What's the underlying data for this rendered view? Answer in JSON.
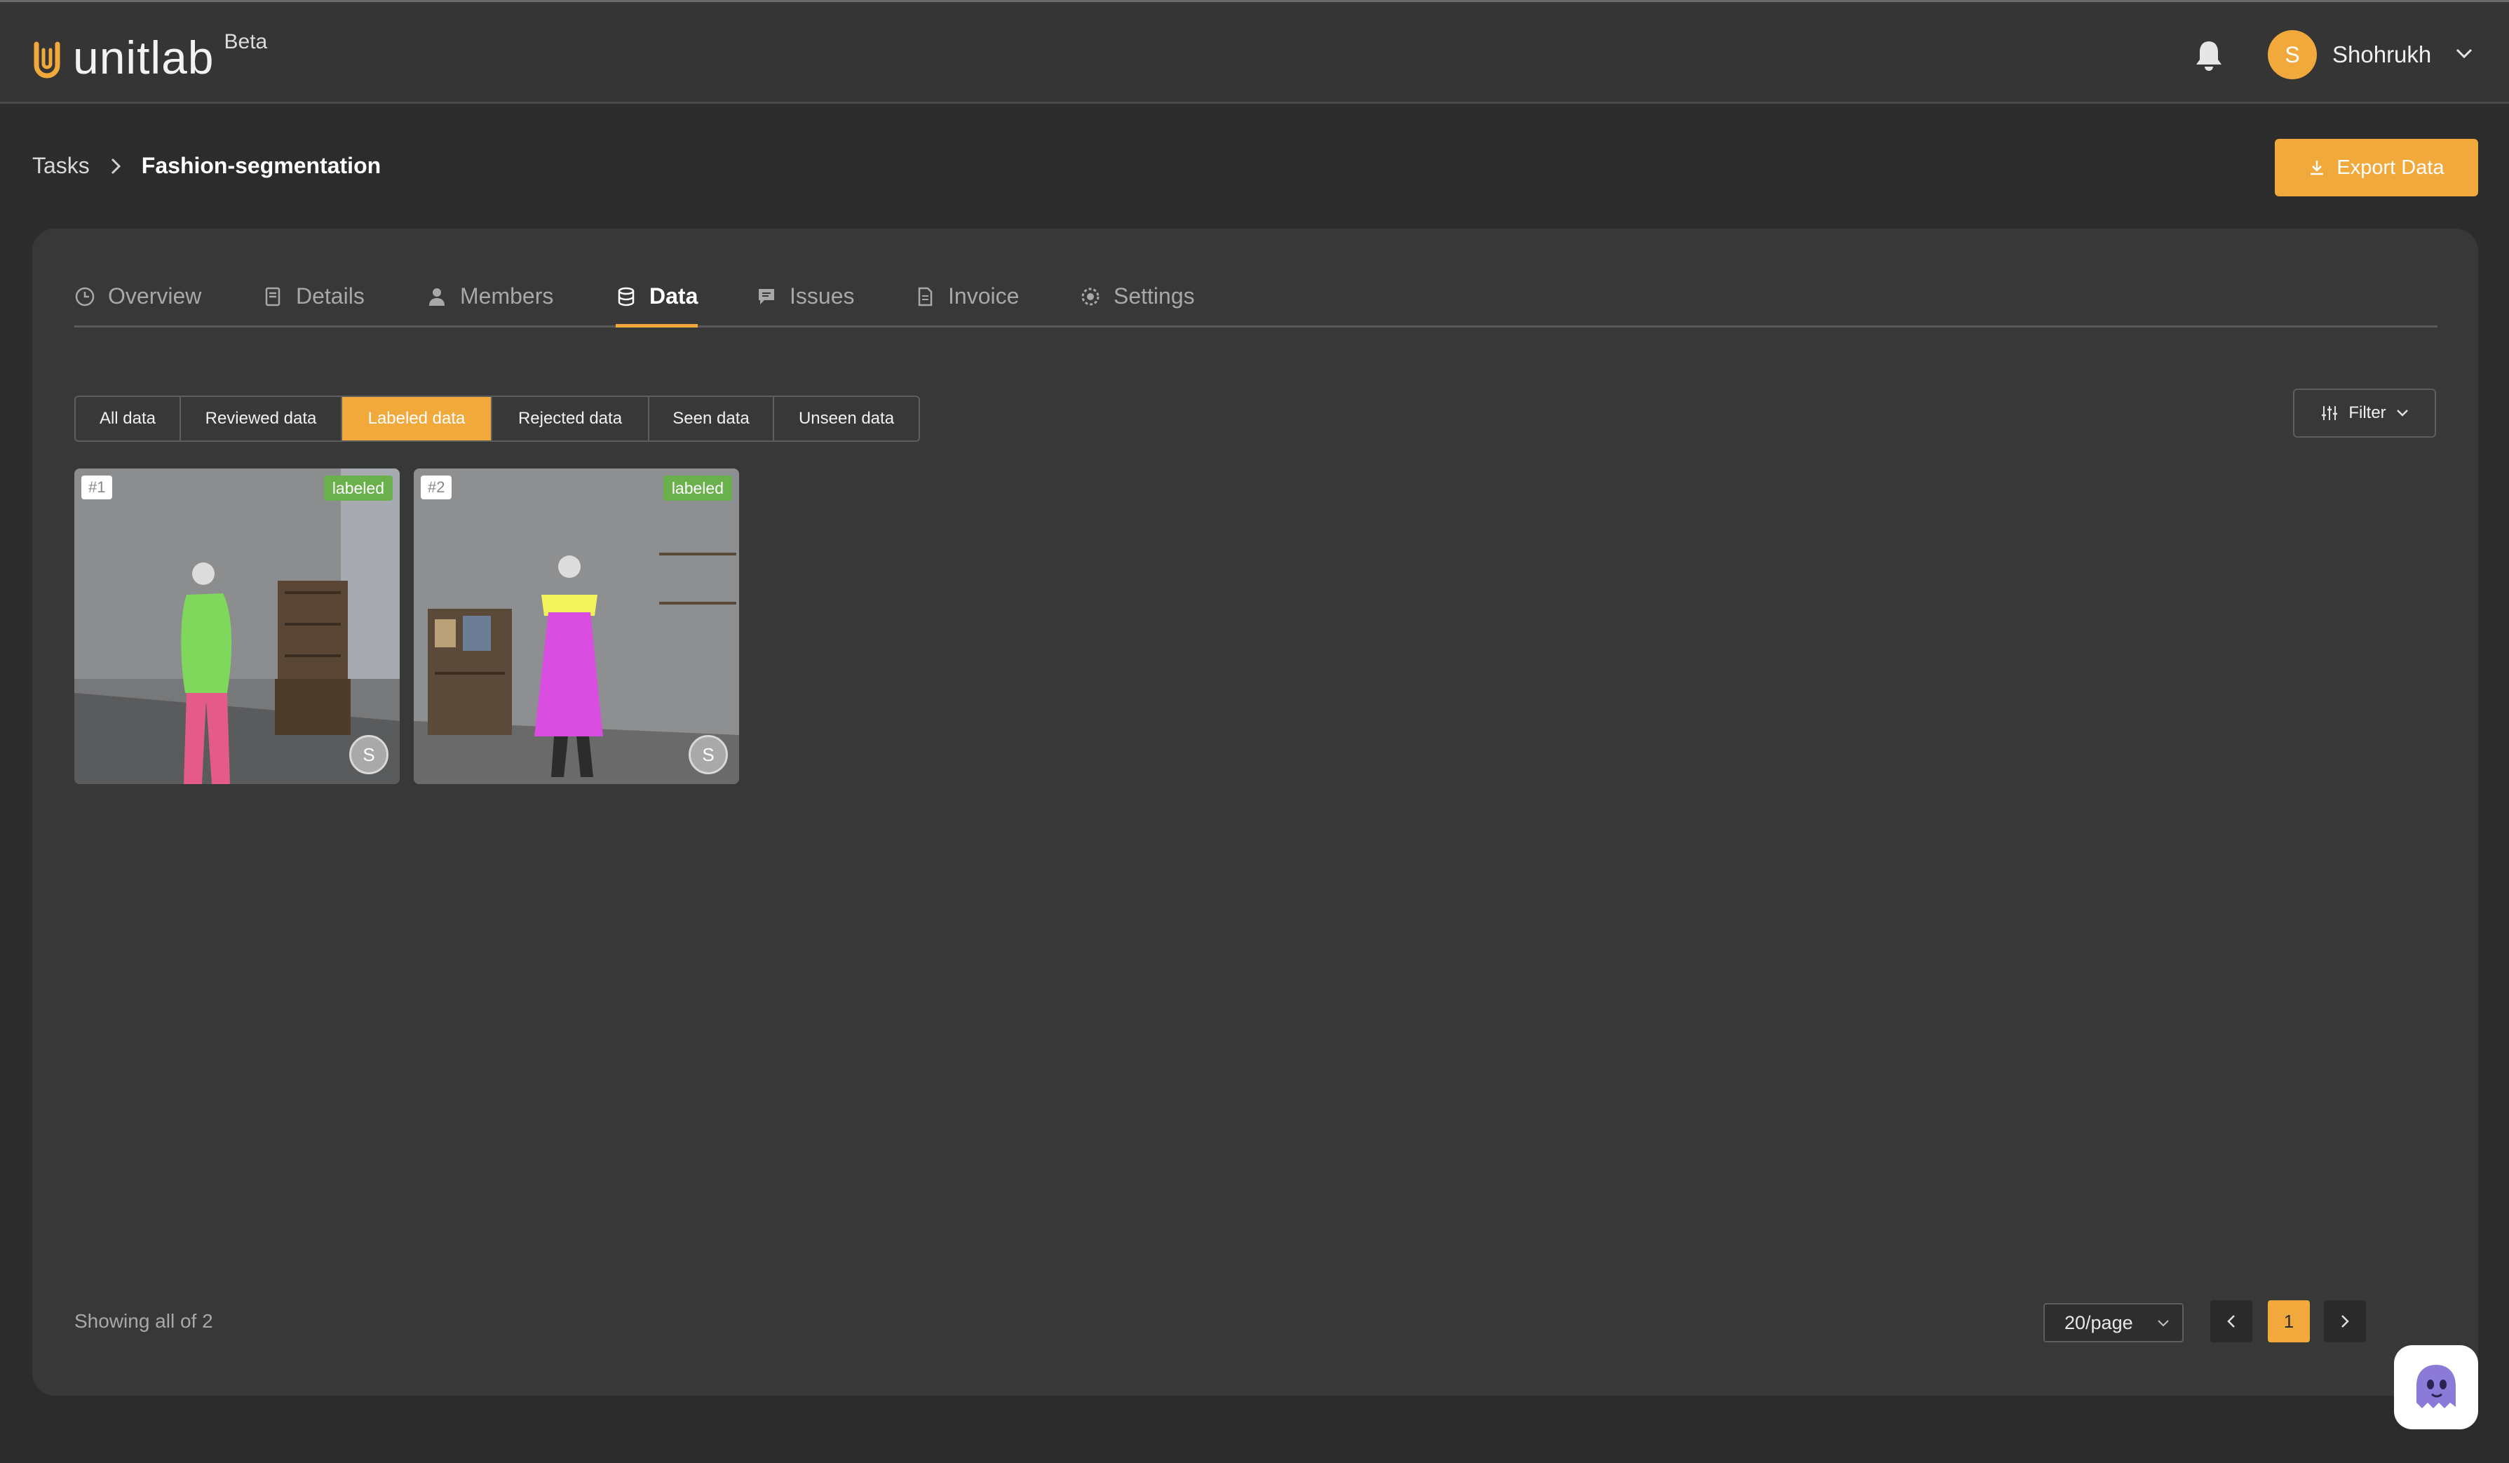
{
  "app": {
    "name": "unitlab",
    "badge": "Beta"
  },
  "header": {
    "user": {
      "initial": "S",
      "name": "Shohrukh"
    },
    "icons": [
      "bell-icon",
      "chevron-down-icon"
    ]
  },
  "breadcrumb": {
    "root": "Tasks",
    "current": "Fashion-segmentation"
  },
  "actions": {
    "export_label": "Export Data"
  },
  "tabs": [
    {
      "label": "Overview",
      "icon": "clock-icon"
    },
    {
      "label": "Details",
      "icon": "document-icon"
    },
    {
      "label": "Members",
      "icon": "user-icon"
    },
    {
      "label": "Data",
      "icon": "database-icon",
      "active": true
    },
    {
      "label": "Issues",
      "icon": "chat-icon"
    },
    {
      "label": "Invoice",
      "icon": "invoice-icon"
    },
    {
      "label": "Settings",
      "icon": "gear-icon"
    }
  ],
  "filters": {
    "segments": [
      "All data",
      "Reviewed data",
      "Labeled data",
      "Rejected data",
      "Seen data",
      "Unseen data"
    ],
    "active": "Labeled data",
    "filter_label": "Filter"
  },
  "items": [
    {
      "number": "#1",
      "status": "labeled",
      "assignee_initial": "S"
    },
    {
      "number": "#2",
      "status": "labeled",
      "assignee_initial": "S"
    }
  ],
  "footer": {
    "showing": "Showing all of 2",
    "page_size": "20/page",
    "current_page": "1"
  },
  "colors": {
    "accent": "#f2a93b",
    "status_labeled": "#6ab04c",
    "panel": "#383838",
    "background": "#2c2c2c"
  }
}
